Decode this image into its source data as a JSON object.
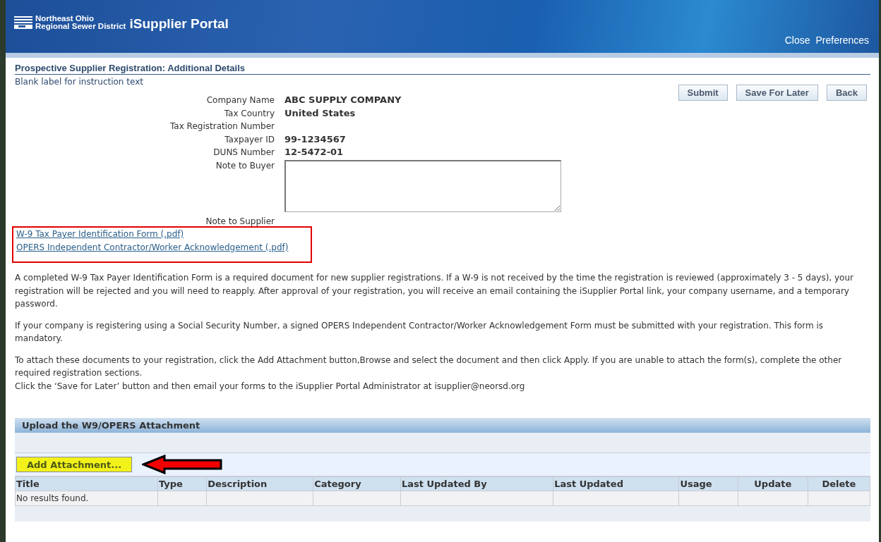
{
  "header": {
    "logo_lines": [
      "Northeast Ohio",
      "Regional Sewer District"
    ],
    "app_name": "iSupplier Portal",
    "links": [
      "Close",
      "Preferences"
    ]
  },
  "page": {
    "title": "Prospective Supplier Registration: Additional Details",
    "instruction": "Blank label for instruction text",
    "buttons": [
      "Submit",
      "Save For Later",
      "Back"
    ]
  },
  "fields": [
    {
      "label": "Company Name",
      "value": "ABC SUPPLY COMPANY",
      "kind": "text"
    },
    {
      "label": "Tax Country",
      "value": "United States",
      "kind": "text"
    },
    {
      "label": "Tax Registration Number",
      "kind": "text"
    },
    {
      "label": "Taxpayer ID",
      "value": "99-1234567",
      "kind": "text"
    },
    {
      "label": "DUNS Number",
      "value": "12-5472-01",
      "kind": "text"
    },
    {
      "label": "Note to Buyer",
      "kind": "textarea"
    },
    {
      "label": "Note to Supplier",
      "kind": "text"
    }
  ],
  "form_links": {
    "highlighted": true,
    "items": [
      "W-9 Tax Payer Identification Form (.pdf)",
      "OPERS Independent Contractor/Worker Acknowledgement (.pdf)"
    ]
  },
  "paragraphs": [
    "A completed W-9 Tax Payer Identification Form is a required document for new supplier registrations. If a W-9 is not received by the time the registration is reviewed (approximately 3 - 5 days), your registration will be rejected and you will need to reapply. After approval of your registration, you will receive an email containing the iSupplier Portal link, your company username, and a temporary password.",
    "If your company is registering using a Social Security Number, a signed OPERS Independent Contractor/Worker Acknowledgement Form must be submitted with your registration. This form is mandatory.",
    "To attach these documents to your registration, click the Add Attachment button,Browse and select the document and then click Apply. If you are unable to attach the form(s), complete the other required registration sections.\nClick the ‘Save for Later’ button and then email your forms to the iSupplier Portal Administrator at isupplier@neorsd.org"
  ],
  "attachments": {
    "title": "Upload the W9/OPERS Attachment",
    "add_button": {
      "label": "Add Attachment...",
      "highlighted": true
    },
    "arrow": true,
    "columns": [
      "Title",
      "Type",
      "Description",
      "Category",
      "Last Updated By",
      "Last Updated",
      "Usage",
      "Update",
      "Delete"
    ],
    "empty_text": "No results found."
  }
}
